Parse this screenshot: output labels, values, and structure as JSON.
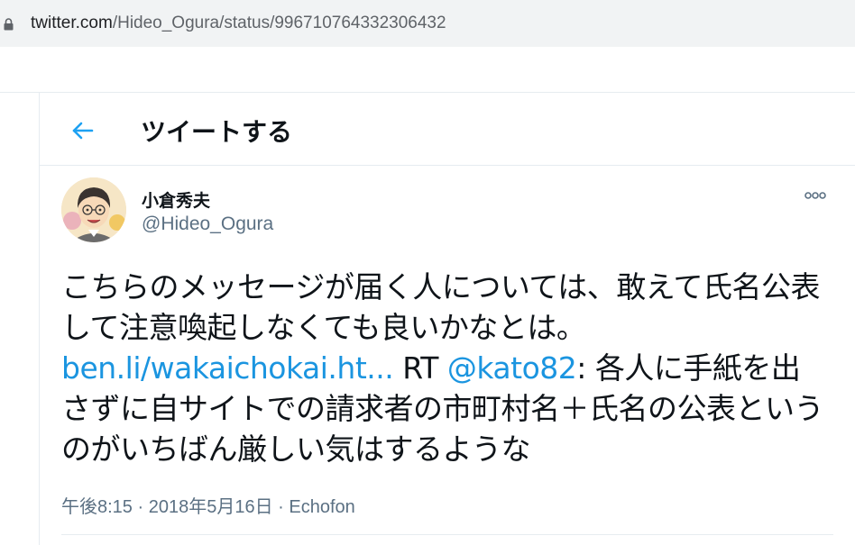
{
  "browser": {
    "url_host": "twitter.com",
    "url_path": "/Hideo_Ogura/status/996710764332306432"
  },
  "header": {
    "title": "ツイートする"
  },
  "tweet": {
    "author_name": "小倉秀夫",
    "author_handle": "@Hideo_Ogura",
    "text_part1": "こちらのメッセージが届く人については、敢えて氏名公表して注意喚起しなくても良いかなとは。",
    "link": "ben.li/wakaichokai.ht...",
    "text_part2": " RT ",
    "mention": "@kato82",
    "text_part3": ": 各人に手紙を出さずに自サイトでの請求者の市町村名＋氏名の公表というのがいちばん厳しい気はするような",
    "time": "午後8:15",
    "date": "2018年5月16日",
    "source": "Echofon",
    "separator": " · "
  },
  "colors": {
    "link": "#1b95e0",
    "secondary_text": "#5b7083",
    "back_arrow": "#1da1f2"
  },
  "icons": [
    "lock-icon",
    "back-arrow-icon",
    "more-options-icon"
  ]
}
